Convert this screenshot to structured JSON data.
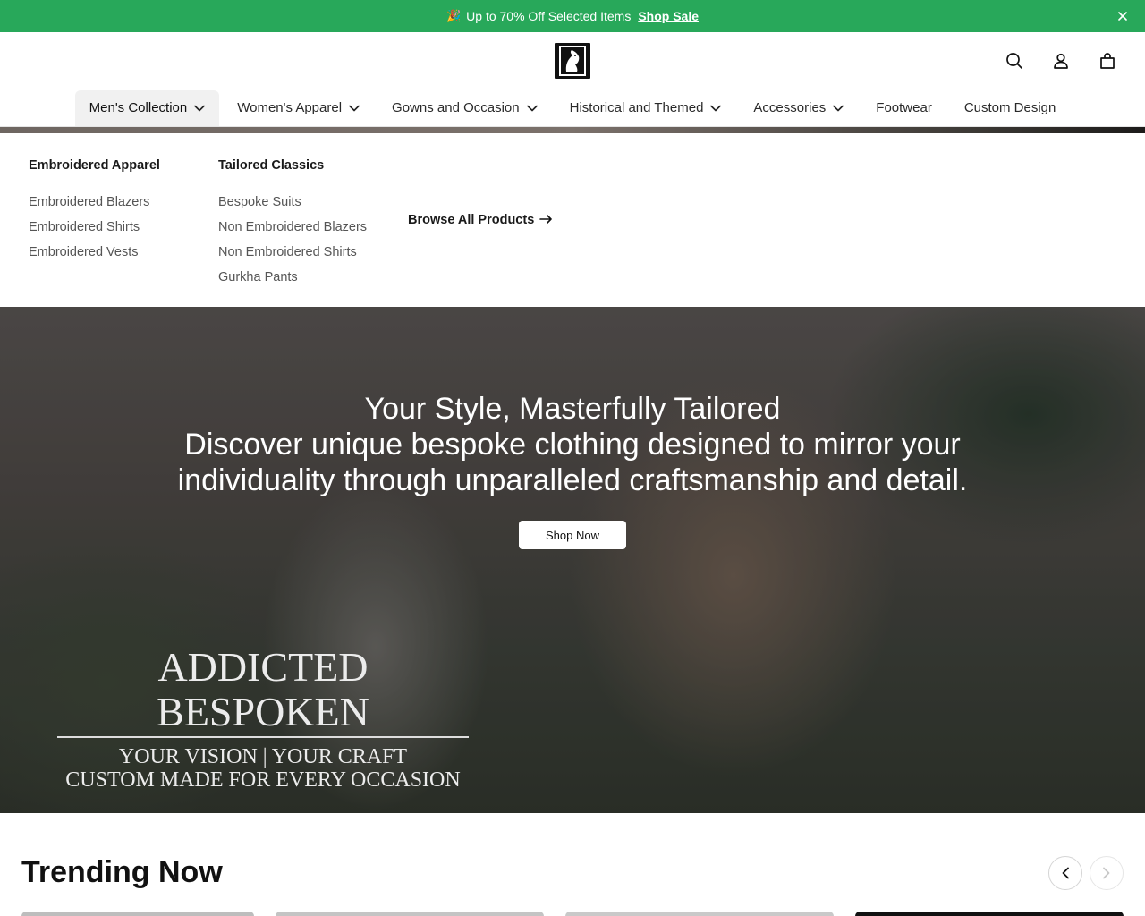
{
  "announcement": {
    "emoji": "🎉",
    "text": "Up to 70% Off Selected Items",
    "link_label": "Shop Sale"
  },
  "header": {
    "icons": [
      "search-icon",
      "account-icon",
      "cart-icon"
    ]
  },
  "nav": {
    "items": [
      {
        "label": "Men's Collection",
        "dropdown": true,
        "active": true
      },
      {
        "label": "Women's Apparel",
        "dropdown": true
      },
      {
        "label": "Gowns and Occasion",
        "dropdown": true
      },
      {
        "label": "Historical and Themed",
        "dropdown": true
      },
      {
        "label": "Accessories",
        "dropdown": true
      },
      {
        "label": "Footwear",
        "dropdown": false
      },
      {
        "label": "Custom Design",
        "dropdown": false
      }
    ]
  },
  "mega_menu": {
    "columns": [
      {
        "heading": "Embroidered Apparel",
        "links": [
          "Embroidered Blazers",
          "Embroidered Shirts",
          "Embroidered Vests"
        ]
      },
      {
        "heading": "Tailored Classics",
        "links": [
          "Bespoke Suits",
          "Non Embroidered Blazers",
          "Non Embroidered Shirts",
          "Gurkha Pants"
        ]
      }
    ],
    "browse_all": "Browse All Products"
  },
  "hero": {
    "title": "Your Style, Masterfully Tailored",
    "subtitle": "Discover unique bespoke clothing designed to mirror your individuality through unparalleled craftsmanship and detail.",
    "cta": "Shop Now",
    "watermark": {
      "main": "ADDICTED BESPOKEN",
      "line1": "YOUR VISION | YOUR CRAFT",
      "line2": "CUSTOM MADE FOR EVERY OCCASION"
    }
  },
  "trending": {
    "title": "Trending Now"
  },
  "colors": {
    "announcement_bg": "#28a85a",
    "text": "#1a1a1a"
  }
}
